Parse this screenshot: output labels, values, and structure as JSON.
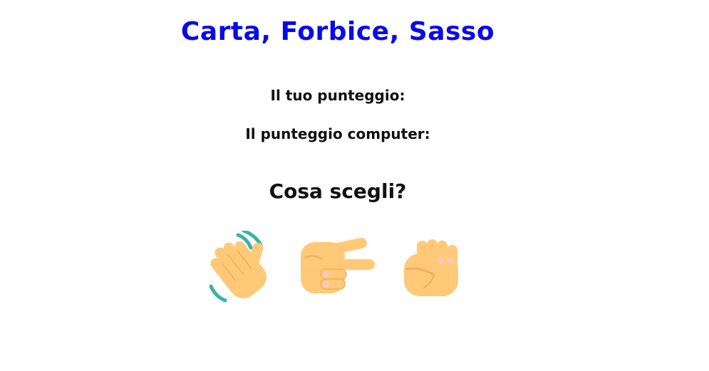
{
  "game": {
    "title": "Carta, Forbice, Sasso",
    "score_you_label": "Il tuo punteggio:",
    "score_computer_label": "Il punteggio computer:",
    "prompt": "Cosa scegli?"
  },
  "choices": [
    {
      "id": "paper",
      "icon": "waving-hand-icon"
    },
    {
      "id": "scissors",
      "icon": "horizontal-v-sign-hand-icon"
    },
    {
      "id": "rock",
      "icon": "raised-fist-icon"
    }
  ],
  "colors": {
    "title": "#0a0aeb",
    "text": "#111111",
    "skin": "#FFC978",
    "skin_shadow": "#F2AC5E",
    "wave_lines": "#3BB3A6",
    "knuckle": "#F7C7C2"
  }
}
